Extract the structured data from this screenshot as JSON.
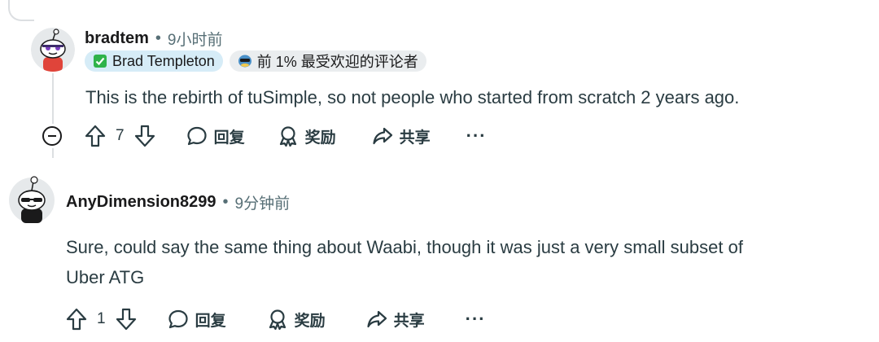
{
  "comments": [
    {
      "username": "bradtem",
      "time": "9小时前",
      "flairs": [
        {
          "icon": "check-icon",
          "text": "Brad Templeton"
        },
        {
          "icon": "top-commenter-icon",
          "text": "前 1% 最受欢迎的评论者"
        }
      ],
      "text": "This is the rebirth of tuSimple, so not people who started from scratch 2 years ago.",
      "votes": "7",
      "reply": "回复",
      "award": "奖励",
      "share": "共享",
      "more": "···"
    },
    {
      "username": "AnyDimension8299",
      "time": "9分钟前",
      "text_lines": [
        "Sure, could say the same thing about Waabi, though it was just a very small subset of",
        "Uber ATG"
      ],
      "votes": "1",
      "reply": "回复",
      "award": "奖励",
      "share": "共享",
      "more": "···"
    }
  ],
  "separator": "•",
  "colors": {
    "flair_verified": "#d6ecf7",
    "flair_top": "#eaedef",
    "check": "#2fb34a",
    "text": "#2a3c42",
    "muted": "#576f76"
  }
}
